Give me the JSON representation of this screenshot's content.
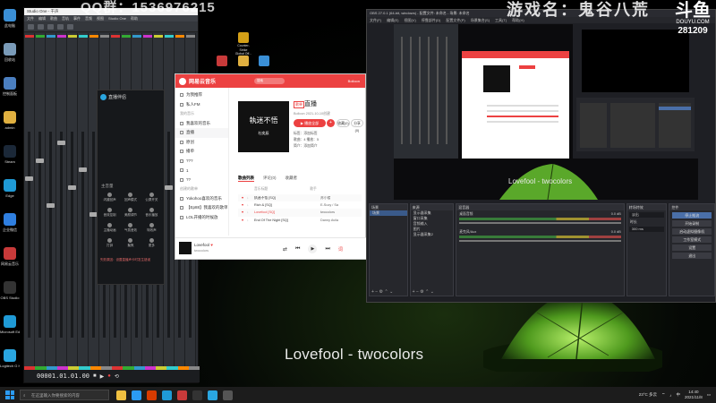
{
  "watermark_left": "QQ群：1536976215",
  "watermark_right": "游戏名：鬼谷八荒",
  "douyu": {
    "logo": "斗鱼",
    "site": "DOUYU.COM",
    "room": "281209"
  },
  "caption": "Lovefool - twocolors",
  "desktop_icons": [
    {
      "label": "此电脑",
      "color": "#3a8fd6"
    },
    {
      "label": "回收站",
      "color": "#7a9bb8"
    },
    {
      "label": "控制面板",
      "color": "#4b7fc0"
    },
    {
      "label": "admin",
      "color": "#e0b040"
    },
    {
      "label": "Steam",
      "color": "#1b2838"
    },
    {
      "label": "Edge",
      "color": "#1f9ad6"
    },
    {
      "label": "企业微信",
      "color": "#2f7fe0"
    },
    {
      "label": "网易云音乐",
      "color": "#c83a3a"
    },
    {
      "label": "OBS Studio",
      "color": "#333"
    },
    {
      "label": "Microsoft Edge",
      "color": "#1f9ad6"
    },
    {
      "label": "Logitech G HUB",
      "color": "#2aa6e0"
    }
  ],
  "mid_shortcuts": [
    {
      "label": "Counter-Strike Global Off...",
      "color": "#d4a017"
    },
    {
      "label": "",
      "color": "#c83a3a"
    },
    {
      "label": "",
      "color": "#e0b040"
    },
    {
      "label": "",
      "color": "#3a8fd6"
    }
  ],
  "studio": {
    "title": "Studio One - 干声",
    "menu": [
      "文件",
      "编辑",
      "歌曲",
      "音轨",
      "事件",
      "音频",
      "视图",
      "Studio One",
      "帮助"
    ],
    "time": "00001.01.01.00",
    "strip_colors": [
      "#d33",
      "#3a3",
      "#39c",
      "#c3c",
      "#cc3",
      "#3cc",
      "#f80",
      "#888",
      "#d33",
      "#3a3",
      "#39c",
      "#c3c",
      "#cc3",
      "#3cc",
      "#f80",
      "#888"
    ]
  },
  "soundcard": {
    "name": "直播伴侣",
    "section": "主音量",
    "buttons": [
      "闪避回声",
      "回声模式",
      "公屏开关",
      "音效控制",
      "美颜调节",
      "音乐播放",
      "主播动画",
      "气氛音效",
      "特效声",
      "打钟",
      "聚焦",
      "更多"
    ],
    "warning": "失败原因：设置直播声卡时发生错误"
  },
  "netease": {
    "app_title": "网易云音乐",
    "search_placeholder": "搜索",
    "user": "Bolloon",
    "sidebar": [
      {
        "label": "为我推荐",
        "type": "item"
      },
      {
        "label": "私人FM",
        "type": "item"
      },
      {
        "label": "我的音乐",
        "type": "section"
      },
      {
        "label": "我喜欢的音乐",
        "type": "item"
      },
      {
        "label": "直播",
        "type": "item",
        "selected": true
      },
      {
        "label": "原创",
        "type": "item"
      },
      {
        "label": "播单",
        "type": "item"
      },
      {
        "label": "???",
        "type": "item"
      },
      {
        "label": "1",
        "type": "item"
      },
      {
        "label": "??",
        "type": "item"
      },
      {
        "label": "创建的歌单",
        "type": "section"
      },
      {
        "label": "Yokohoo喜欢的音乐",
        "type": "item"
      },
      {
        "label": "【Ep88】我喜欢的歌单",
        "type": "item"
      },
      {
        "label": "LOL开播的时候放",
        "type": "item"
      }
    ],
    "cover_title": "執迷不悟",
    "cover_sub": "杜奕辰",
    "playlist_tag": "歌单",
    "playlist_title": "直播",
    "creator": "Bolloon  2021-10-10创建",
    "play_all": "▶ 播放全部",
    "add": "+",
    "collect": "收藏(0)",
    "share": "分享(0)",
    "info_tags": "标签：添加标签",
    "info_count": "歌曲：4   播放：5",
    "info_desc": "简介：添加简介",
    "tabs": [
      "歌曲列表",
      "评论(0)",
      "收藏者"
    ],
    "thead_title": "音乐标题",
    "thead_artist": "歌手",
    "rows": [
      {
        "title": "执迷不悟 [SQ]",
        "artist": "苏小楼",
        "current": false
      },
      {
        "title": "Rich & [SQ]",
        "artist": "E-Sucy / Sa",
        "current": false
      },
      {
        "title": "Lovefool [SQ]",
        "artist": "twocolors",
        "current": true
      },
      {
        "title": "End Of The Night [SQ]",
        "artist": "Danny Avila",
        "current": false
      }
    ],
    "now_title": "Lovefool",
    "now_heart": "♥",
    "now_artist": "twocolors",
    "ctrl_prev": "⏮",
    "ctrl_play": "▶",
    "ctrl_next": "⏭",
    "ctrl_shuffle": "⇄",
    "ctrl_like": "♥",
    "ctrl_lyric": "词"
  },
  "obs": {
    "title": "OBS 27.0.1 (64-bit, windows) - 配置文件: 未命名 - 场景: 未命名",
    "menu": [
      "文件(F)",
      "编辑(E)",
      "视图(V)",
      "停靠部件(D)",
      "配置文件(P)",
      "场景集合(S)",
      "工具(T)",
      "帮助(H)"
    ],
    "preview_caption": "Lovefool - twocolors",
    "docks": {
      "scenes": {
        "title": "场景",
        "items": [
          "场景"
        ]
      },
      "sources": {
        "title": "来源",
        "items": [
          "显示器采集",
          "窗口采集",
          "音频输入",
          "图片",
          "显示器采集2"
        ]
      },
      "mixer": {
        "title": "混音器",
        "channels": [
          {
            "name": "桌面音频",
            "db": "0.0 dB"
          },
          {
            "name": "麦克风/Aux",
            "db": "0.0 dB"
          }
        ]
      },
      "transitions": {
        "title": "转场特效",
        "mode": "淡出",
        "duration_label": "时长",
        "duration": "300 ms"
      },
      "controls": {
        "title": "控件",
        "buttons": [
          "停止推流",
          "开始录制",
          "启动虚拟摄像机",
          "工作室模式",
          "设置",
          "退出"
        ],
        "active": 0
      }
    },
    "stats": "LIVE: 00:00:00  REC: 00:00:00  CPU: 5.0%, 60.00 fps"
  },
  "taskbar": {
    "search": "在这里输入你要搜索的内容",
    "apps": [
      "#f0c040",
      "#2b9bf3",
      "#d83b01",
      "#1f9ad6",
      "#c83a3a",
      "#333",
      "#2aa6e0",
      "#555"
    ],
    "weather": "23°C 多云",
    "lang": "中",
    "time": "14:40",
    "date": "2021/11/8"
  }
}
